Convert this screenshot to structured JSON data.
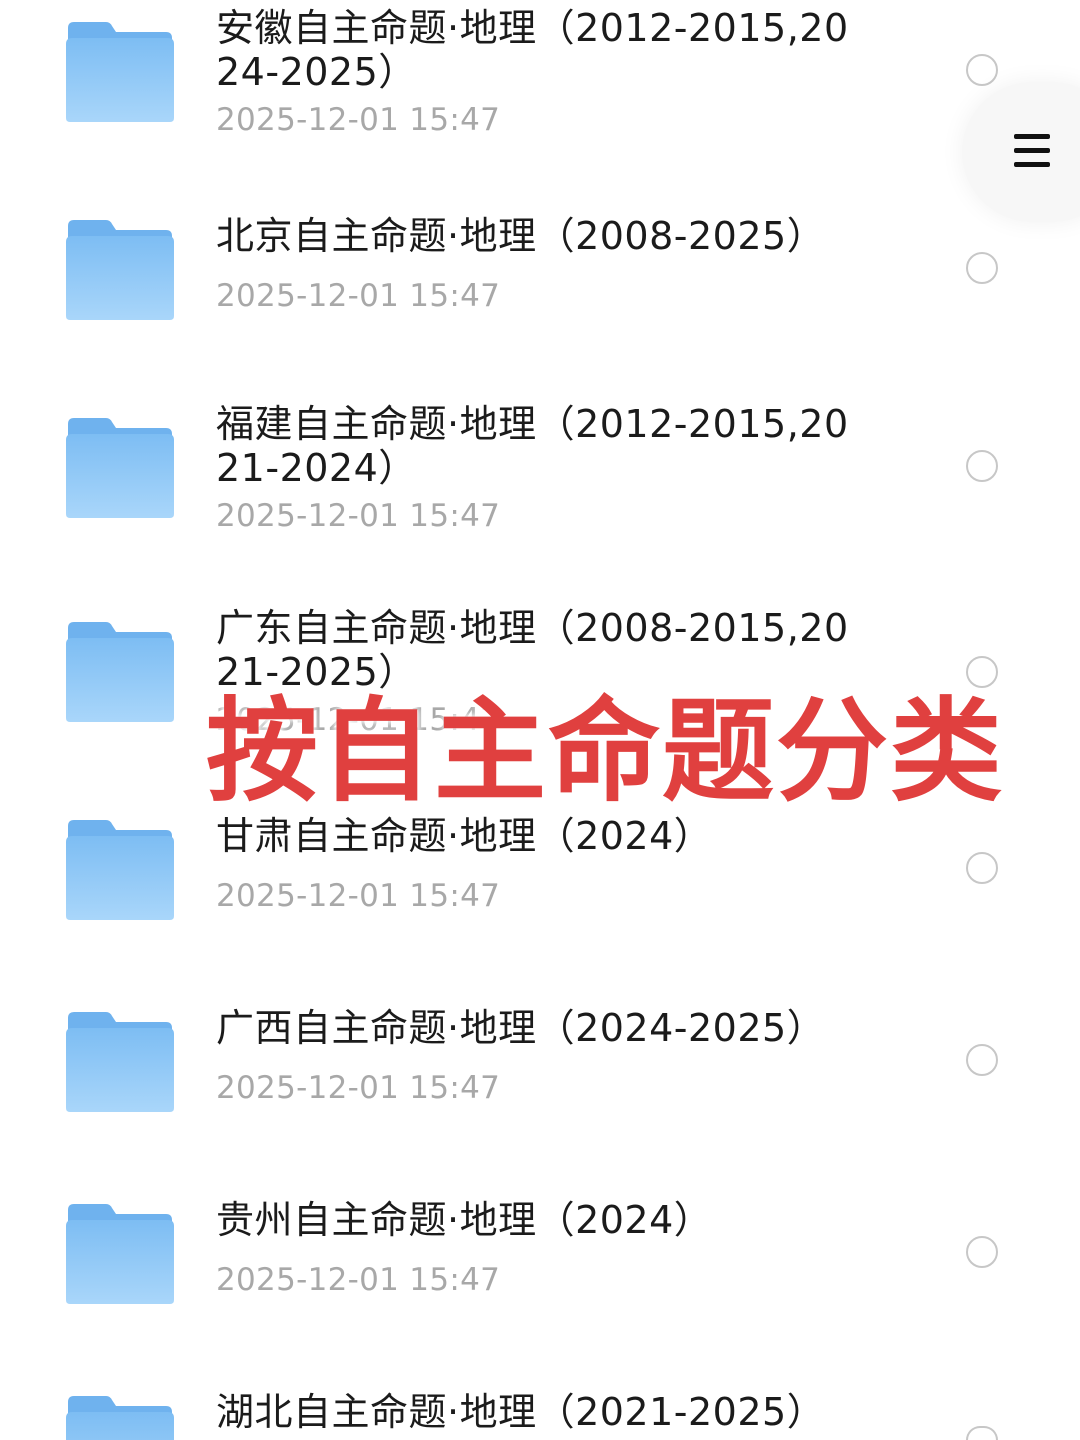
{
  "files": [
    {
      "title": "安徽自主命题·地理（2012-2015,2024-2025）",
      "time": "2025-12-01 15:47"
    },
    {
      "title": "北京自主命题·地理（2008-2025）",
      "time": "2025-12-01 15:47"
    },
    {
      "title": "福建自主命题·地理（2012-2015,2021-2024）",
      "time": "2025-12-01 15:47"
    },
    {
      "title": "广东自主命题·地理（2008-2015,2021-2025）",
      "time": "2025-12-01 15:47"
    },
    {
      "title": "甘肃自主命题·地理（2024）",
      "time": "2025-12-01 15:47"
    },
    {
      "title": "广西自主命题·地理（2024-2025）",
      "time": "2025-12-01 15:47"
    },
    {
      "title": "贵州自主命题·地理（2024）",
      "time": "2025-12-01 15:47"
    },
    {
      "title": "湖北自主命题·地理（2021-2025）",
      "time": ""
    }
  ],
  "overlay": {
    "caption": "按自主命题分类"
  },
  "icons": {
    "folder": "folder-icon",
    "menu": "menu-icon",
    "select": "radio-circle-icon"
  },
  "colors": {
    "folder": "#8cc8f5",
    "caption": "#e0403f",
    "timestamp": "#a8a8a8"
  }
}
